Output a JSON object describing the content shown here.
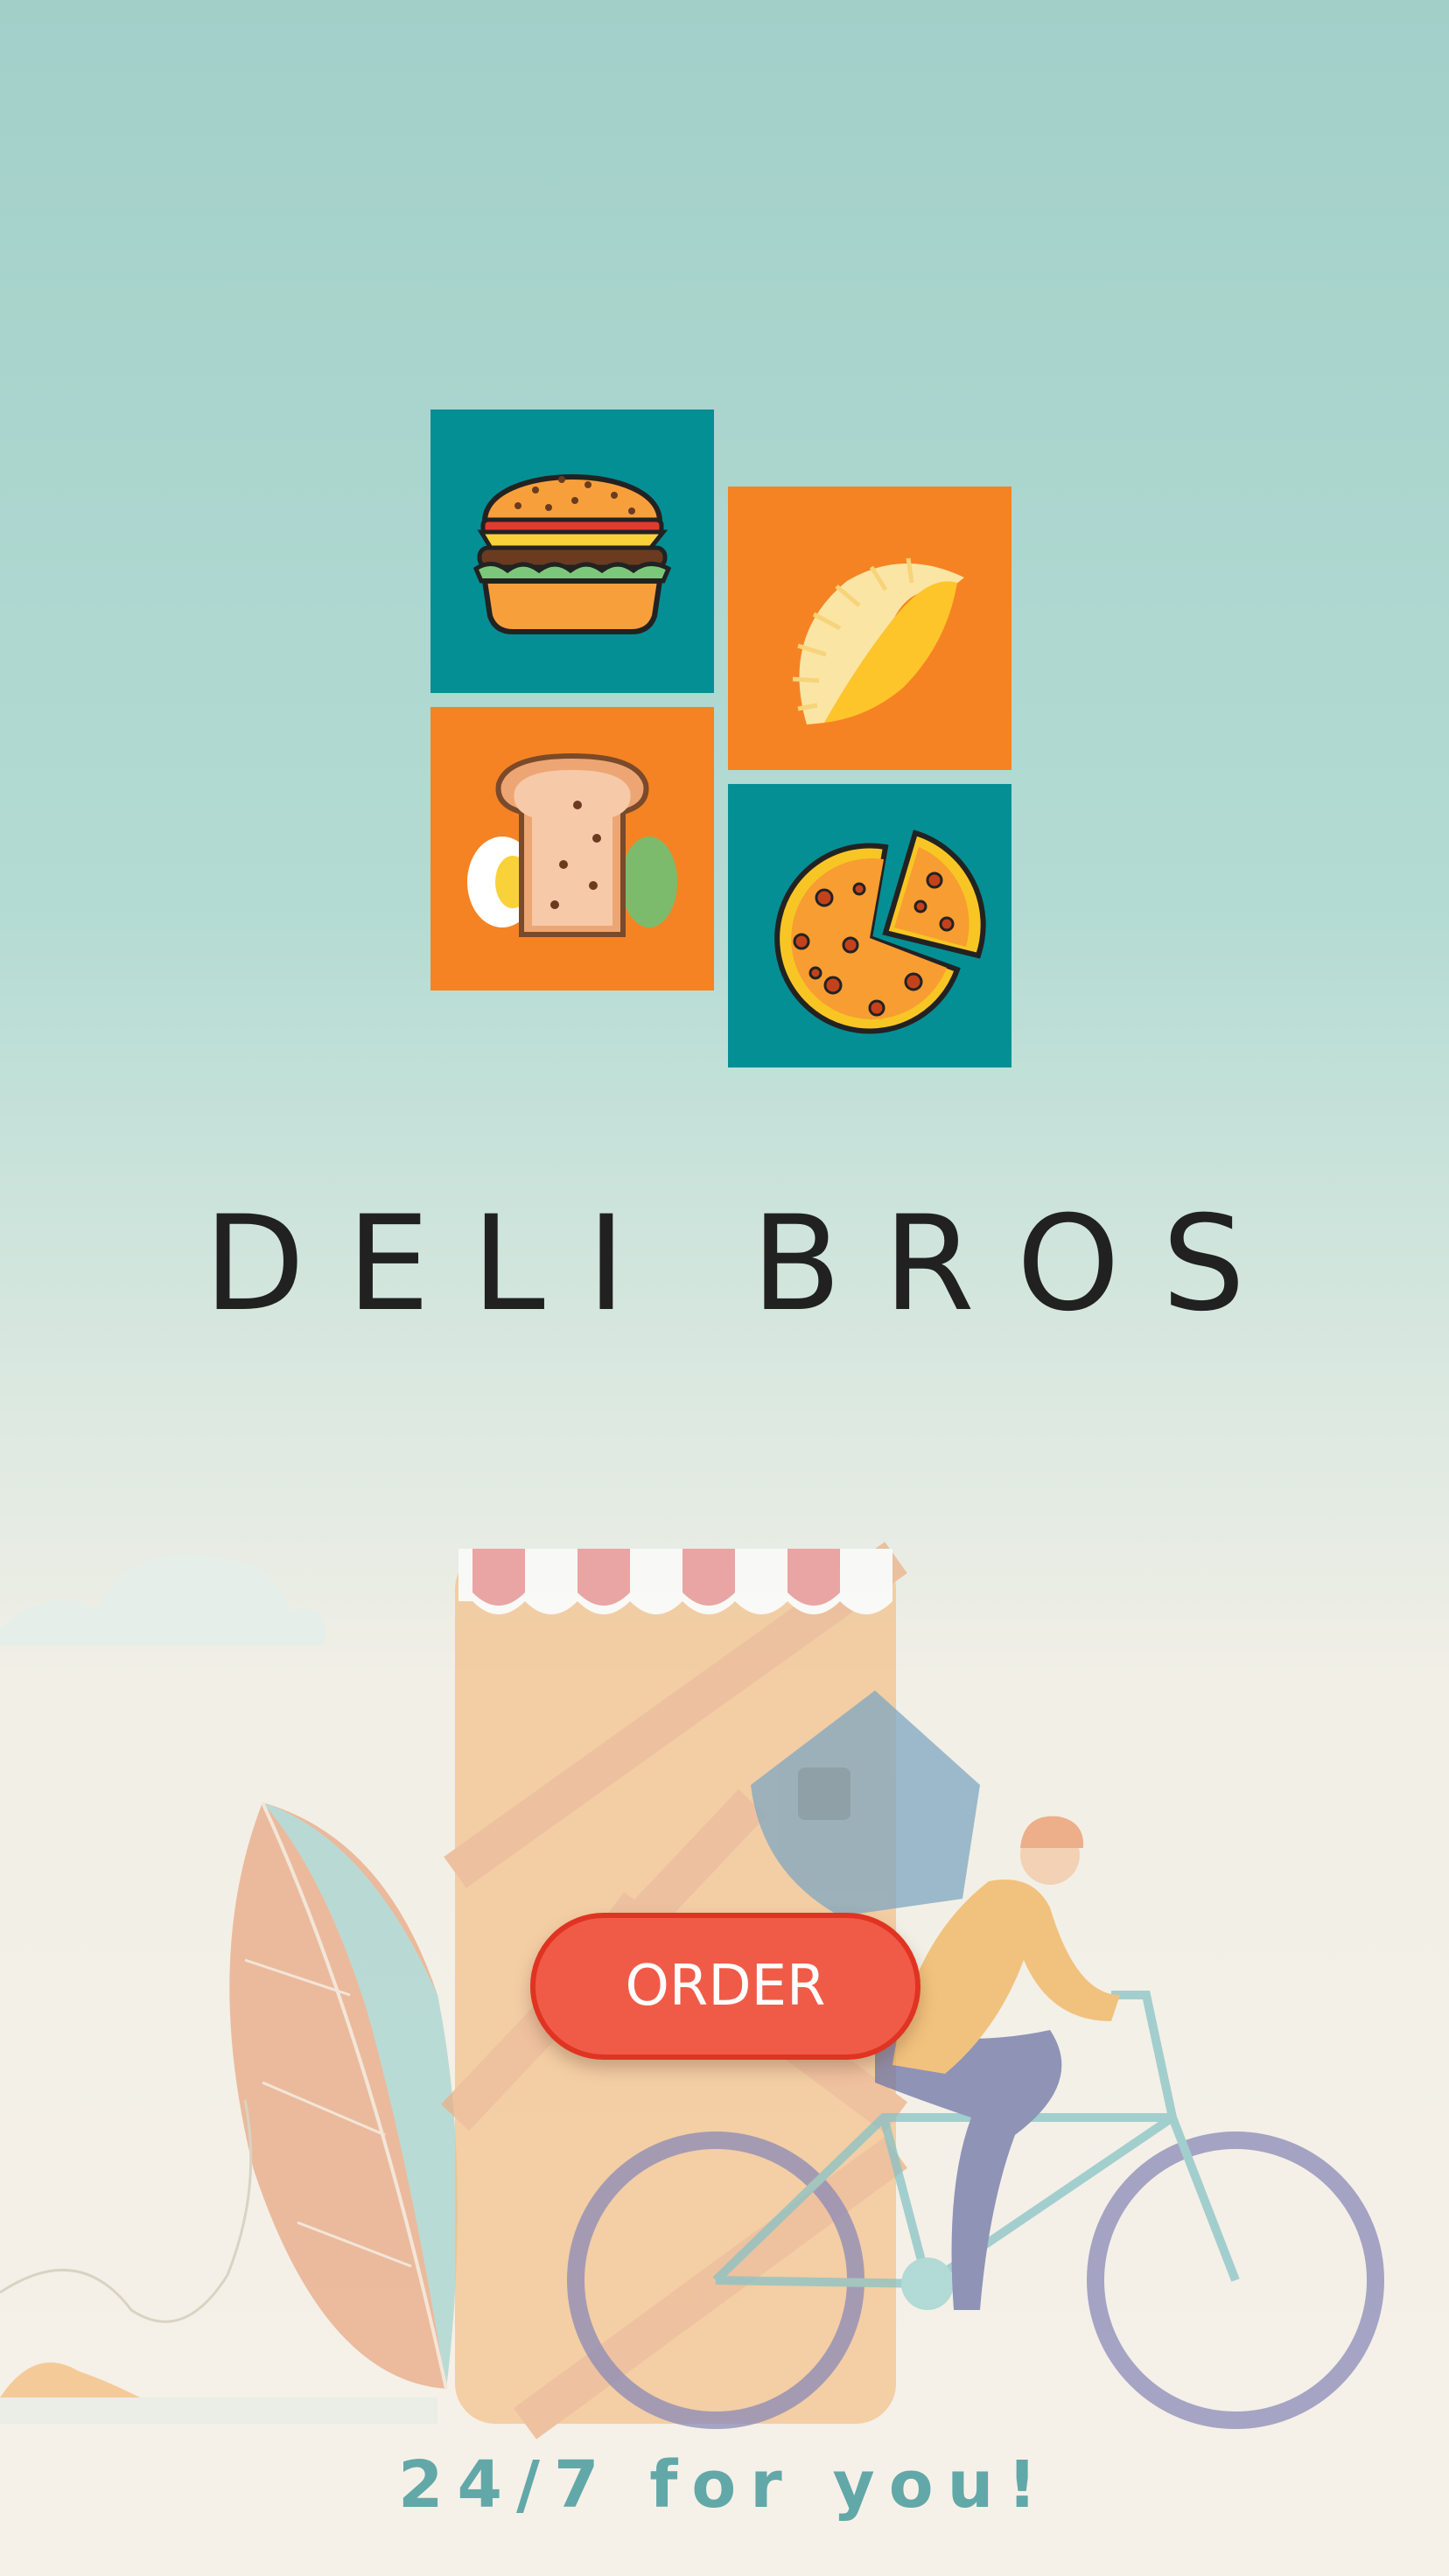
{
  "brand": {
    "name": "DELI BROS",
    "tagline": "24/7 for you!"
  },
  "actions": {
    "order_label": "ORDER"
  },
  "logo_tiles": [
    {
      "icon": "burger-icon",
      "color": "#048f95"
    },
    {
      "icon": "empanada-icon",
      "color": "#f58323"
    },
    {
      "icon": "sandwich-icon",
      "color": "#f58323"
    },
    {
      "icon": "pizza-icon",
      "color": "#048f95"
    }
  ],
  "colors": {
    "teal": "#048f95",
    "orange": "#f58323",
    "button": "#f05b48",
    "tagline": "#62a8a9"
  }
}
